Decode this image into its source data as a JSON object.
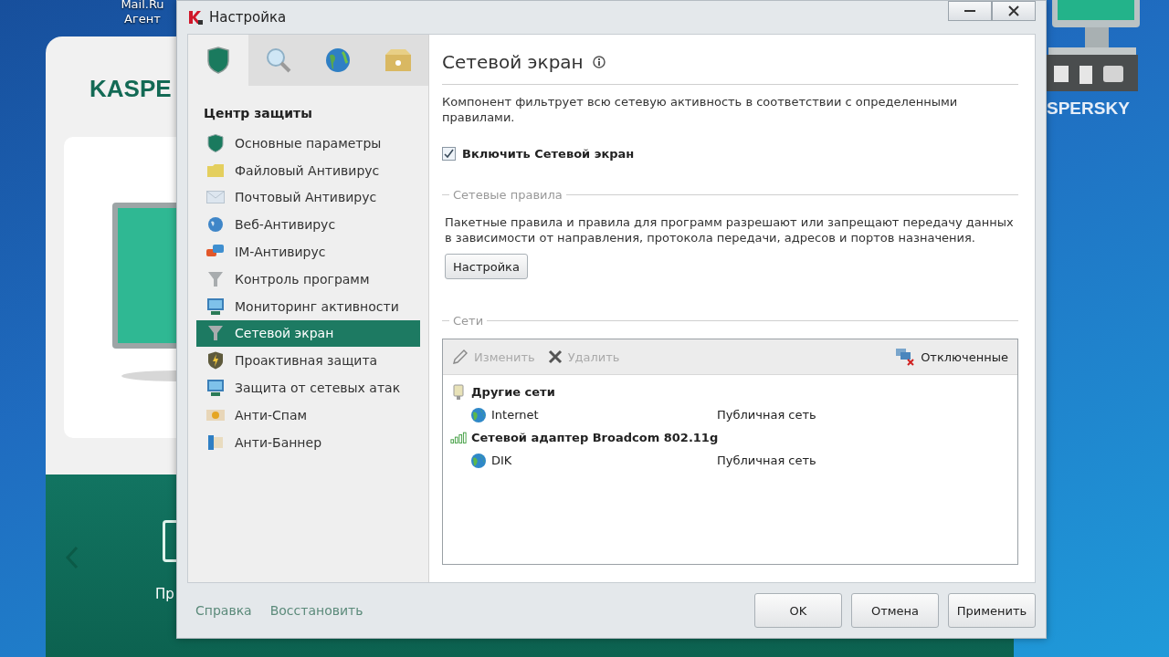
{
  "desktop": {
    "icon_label": "Mail.Ru Агент",
    "gadget_logo": "SPERSKY"
  },
  "background_window": {
    "logo": "KASPE",
    "caption": "Пр"
  },
  "window": {
    "title": "Настройка"
  },
  "tabs": [
    {
      "selected": true
    },
    {
      "selected": false
    },
    {
      "selected": false
    },
    {
      "selected": false
    }
  ],
  "sidebar": {
    "heading": "Центр защиты",
    "items": [
      {
        "label": "Основные параметры",
        "selected": false
      },
      {
        "label": "Файловый Антивирус",
        "selected": false
      },
      {
        "label": "Почтовый Антивирус",
        "selected": false
      },
      {
        "label": "Веб-Антивирус",
        "selected": false
      },
      {
        "label": "IM-Антивирус",
        "selected": false
      },
      {
        "label": "Контроль программ",
        "selected": false
      },
      {
        "label": "Мониторинг активности",
        "selected": false
      },
      {
        "label": "Сетевой экран",
        "selected": true
      },
      {
        "label": "Проактивная защита",
        "selected": false
      },
      {
        "label": "Защита от сетевых атак",
        "selected": false
      },
      {
        "label": "Анти-Спам",
        "selected": false
      },
      {
        "label": "Анти-Баннер",
        "selected": false
      }
    ]
  },
  "panel": {
    "title": "Сетевой экран",
    "description": "Компонент фильтрует всю сетевую активность в соответствии с определенными правилами.",
    "enable_checkbox": {
      "label": "Включить Сетевой экран",
      "checked": true
    },
    "rules_group": {
      "legend": "Сетевые правила",
      "description": "Пакетные правила и правила для программ разрешают или запрещают передачу данных в зависимости от направления, протокола передачи, адресов и портов назначения.",
      "button": "Настройка"
    },
    "networks_group": {
      "legend": "Сети",
      "toolbar": [
        {
          "kind": "edit",
          "label": "Изменить",
          "disabled": true
        },
        {
          "kind": "delete",
          "label": "Удалить",
          "disabled": true
        }
      ],
      "filter": {
        "label": "Отключенные"
      },
      "tree": [
        {
          "kind": "other",
          "name": "Другие сети",
          "children": [
            {
              "name": "Internet",
              "type": "Публичная сеть"
            }
          ]
        },
        {
          "kind": "adapter",
          "name": "Сетевой адаптер Broadcom 802.11g",
          "children": [
            {
              "name": "DIK",
              "type": "Публичная сеть"
            }
          ]
        }
      ]
    }
  },
  "footer": {
    "links": [
      "Справка",
      "Восстановить"
    ],
    "buttons": [
      "OK",
      "Отмена",
      "Применить"
    ]
  }
}
